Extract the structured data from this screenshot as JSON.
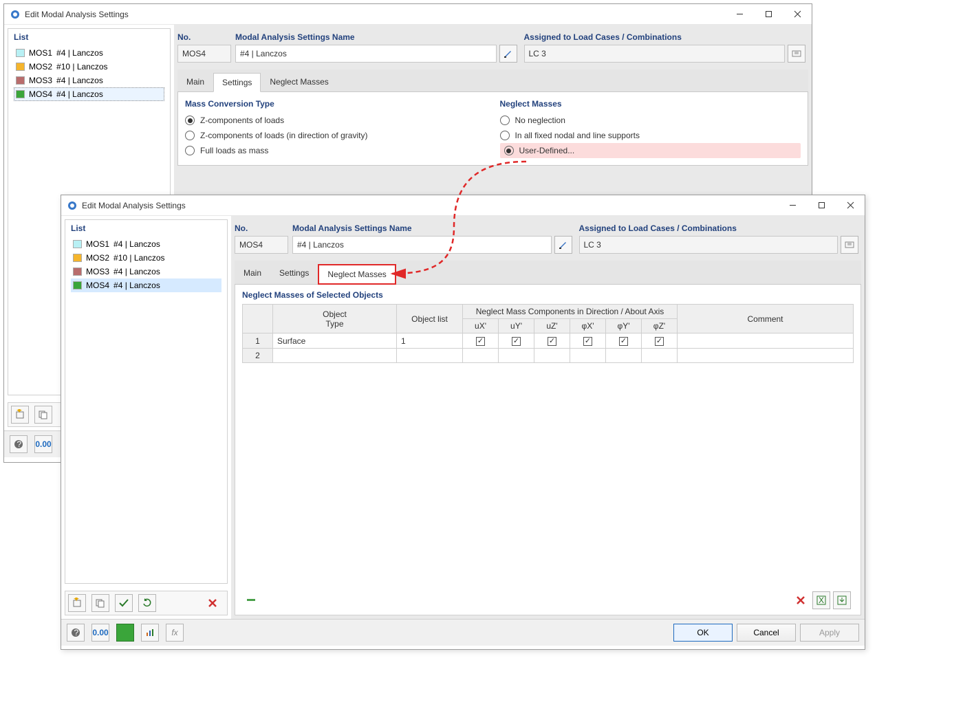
{
  "colors": {
    "swatch1": "#b8f0f4",
    "swatch2": "#f5b52c",
    "swatch3": "#b96d6d",
    "swatch4": "#3aa53a"
  },
  "window1": {
    "title": "Edit Modal Analysis Settings",
    "list_title": "List",
    "list_items": [
      {
        "code": "MOS1",
        "desc": "#4 | Lanczos",
        "swatch": "swatch1"
      },
      {
        "code": "MOS2",
        "desc": "#10 | Lanczos",
        "swatch": "swatch2"
      },
      {
        "code": "MOS3",
        "desc": "#4 | Lanczos",
        "swatch": "swatch3"
      },
      {
        "code": "MOS4",
        "desc": "#4 | Lanczos",
        "swatch": "swatch4",
        "selected": true
      }
    ],
    "no_label": "No.",
    "no_value": "MOS4",
    "name_label": "Modal Analysis Settings Name",
    "name_value": "#4 | Lanczos",
    "assigned_label": "Assigned to Load Cases / Combinations",
    "assigned_value": "LC 3",
    "tabs": {
      "main": "Main",
      "settings": "Settings",
      "neglect": "Neglect Masses"
    },
    "mass_group_title": "Mass Conversion Type",
    "mass_opts": {
      "o1": "Z-components of loads",
      "o2": "Z-components of loads (in direction of gravity)",
      "o3": "Full loads as mass"
    },
    "neglect_group_title": "Neglect Masses",
    "neglect_opts": {
      "o1": "No neglection",
      "o2": "In all fixed nodal and line supports",
      "o3": "User-Defined..."
    }
  },
  "window2": {
    "title": "Edit Modal Analysis Settings",
    "list_title": "List",
    "list_items": [
      {
        "code": "MOS1",
        "desc": "#4 | Lanczos",
        "swatch": "swatch1"
      },
      {
        "code": "MOS2",
        "desc": "#10 | Lanczos",
        "swatch": "swatch2"
      },
      {
        "code": "MOS3",
        "desc": "#4 | Lanczos",
        "swatch": "swatch3"
      },
      {
        "code": "MOS4",
        "desc": "#4 | Lanczos",
        "swatch": "swatch4",
        "selected": true
      }
    ],
    "no_label": "No.",
    "no_value": "MOS4",
    "name_label": "Modal Analysis Settings Name",
    "name_value": "#4 | Lanczos",
    "assigned_label": "Assigned to Load Cases / Combinations",
    "assigned_value": "LC 3",
    "tabs": {
      "main": "Main",
      "settings": "Settings",
      "neglect": "Neglect Masses"
    },
    "table_title": "Neglect Masses of Selected Objects",
    "table_head": {
      "object_type": "Object\nType",
      "object_list": "Object list",
      "group": "Neglect Mass Components in Direction / About Axis",
      "cols": [
        "uX'",
        "uY'",
        "uZ'",
        "φX'",
        "φY'",
        "φZ'"
      ],
      "comment": "Comment"
    },
    "rows": [
      {
        "n": "1",
        "type": "Surface",
        "list": "1",
        "c": [
          true,
          true,
          true,
          true,
          true,
          true
        ],
        "comment": ""
      },
      {
        "n": "2",
        "type": "",
        "list": "",
        "c": [
          false,
          false,
          false,
          false,
          false,
          false
        ],
        "comment": ""
      }
    ],
    "buttons": {
      "ok": "OK",
      "cancel": "Cancel",
      "apply": "Apply"
    }
  },
  "decimal_btn": "0.00"
}
